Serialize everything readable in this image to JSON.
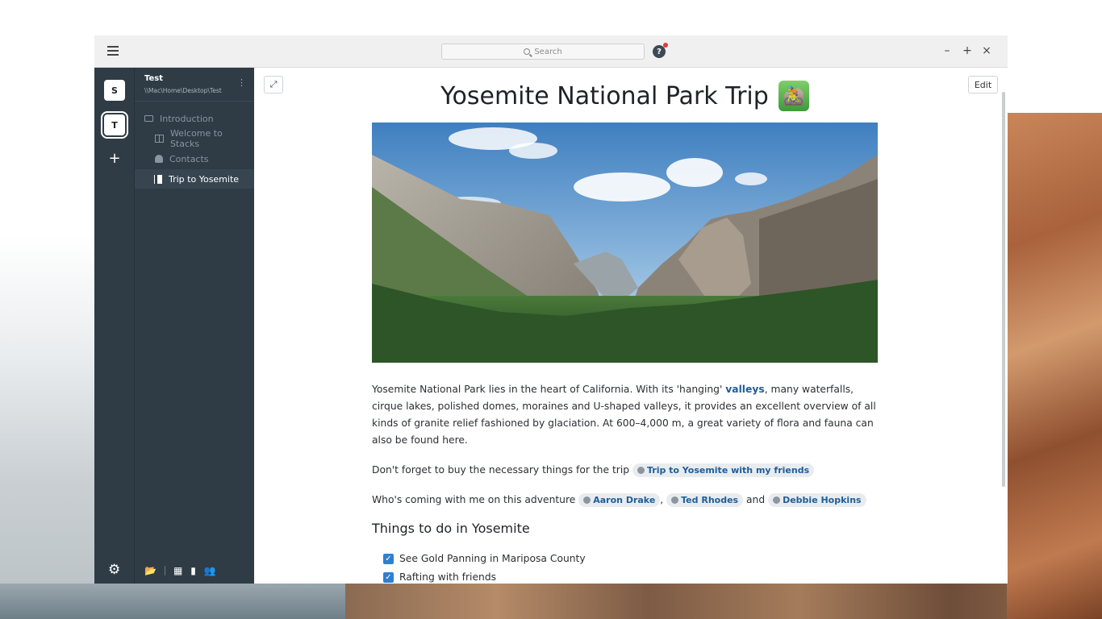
{
  "titlebar": {
    "search_placeholder": "Search",
    "help_label": "?",
    "minimize": "–",
    "maximize": "+",
    "close": "×"
  },
  "rail": {
    "stacks": [
      {
        "letter": "S"
      },
      {
        "letter": "T",
        "active": true
      }
    ],
    "add_label": "+"
  },
  "sidebar": {
    "title": "Test",
    "path": "\\\\Mac\\Home\\Desktop\\Test",
    "items": [
      {
        "label": "Introduction",
        "icon": "folder-icon"
      },
      {
        "label": "Welcome to Stacks",
        "icon": "board-icon"
      },
      {
        "label": "Contacts",
        "icon": "contacts-icon"
      },
      {
        "label": "Trip to Yosemite",
        "icon": "document-icon",
        "active": true
      }
    ]
  },
  "content": {
    "edit_label": "Edit",
    "title": "Yosemite National Park Trip",
    "title_emoji": "🚵",
    "paragraph1_a": "Yosemite National Park lies in the heart of California. With its 'hanging' ",
    "paragraph1_link": "valleys",
    "paragraph1_b": ", many waterfalls, cirque lakes, polished domes, moraines and U-shaped valleys, it provides an excellent overview of all kinds of granite relief fashioned by glaciation. At 600–4,000 m, a great variety of flora and fauna can also be found here.",
    "paragraph2": "Don't forget to buy the necessary things for the trip",
    "paragraph2_chip": "Trip to Yosemite with my friends",
    "paragraph3": "Who's coming with me on this adventure",
    "people": [
      "Aaron Drake",
      "Ted Rhodes",
      "Debbie Hopkins"
    ],
    "sep_comma": ",",
    "sep_and": "and",
    "heading": "Things to do in Yosemite",
    "tasks": [
      {
        "label": "See Gold Panning in Mariposa County",
        "checked": true
      },
      {
        "label": "Rafting with friends",
        "checked": true
      }
    ]
  },
  "colors": {
    "sidebar_bg": "#2f3b45",
    "link": "#1f5d99",
    "checkbox": "#2f7fd1"
  }
}
